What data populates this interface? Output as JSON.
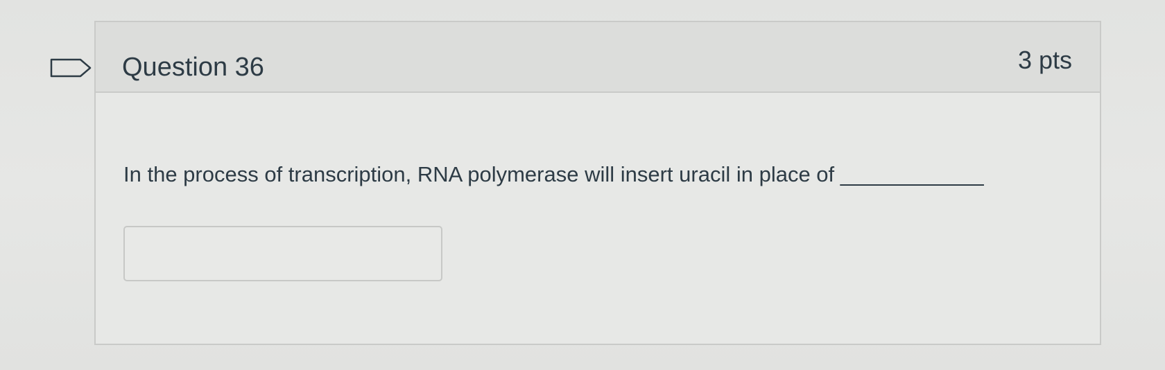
{
  "question": {
    "title": "Question 36",
    "points": "3 pts",
    "text": "In the process of transcription, RNA polymerase will insert uracil in place of ____________",
    "answer_value": "",
    "flag_icon": "flag-outline-icon"
  },
  "colors": {
    "text": "#2d3b45",
    "border": "#c9cac8",
    "header_bg": "#dcdddb"
  }
}
